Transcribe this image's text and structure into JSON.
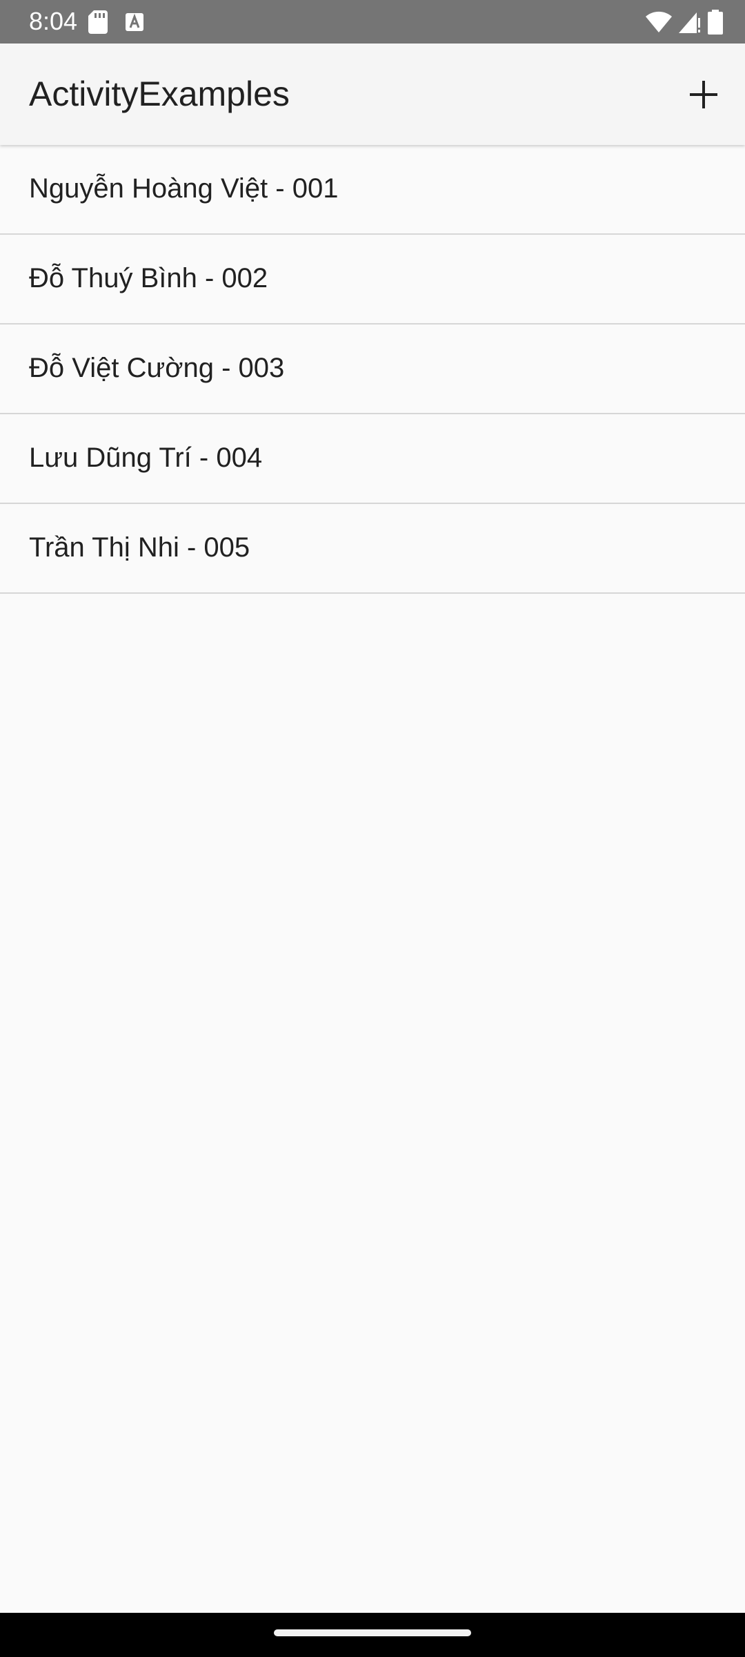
{
  "status_bar": {
    "time": "8:04",
    "icons": [
      "sd-card-icon",
      "keyboard-a-icon",
      "wifi-icon",
      "cellular-signal-icon",
      "battery-icon"
    ],
    "background": "#757575"
  },
  "app_bar": {
    "title": "ActivityExamples",
    "add_icon": "plus-icon"
  },
  "list": {
    "items": [
      {
        "label": "Nguyễn Hoàng Việt - 001"
      },
      {
        "label": "Đỗ Thuý Bình - 002"
      },
      {
        "label": "Đỗ Việt Cường - 003"
      },
      {
        "label": "Lưu Dũng Trí - 004"
      },
      {
        "label": "Trần Thị Nhi - 005"
      }
    ]
  },
  "colors": {
    "app_bar_bg": "#f5f5f5",
    "page_bg": "#fafafa",
    "text": "#212121",
    "divider": "#d6d6d6",
    "nav_bar": "#000000"
  }
}
